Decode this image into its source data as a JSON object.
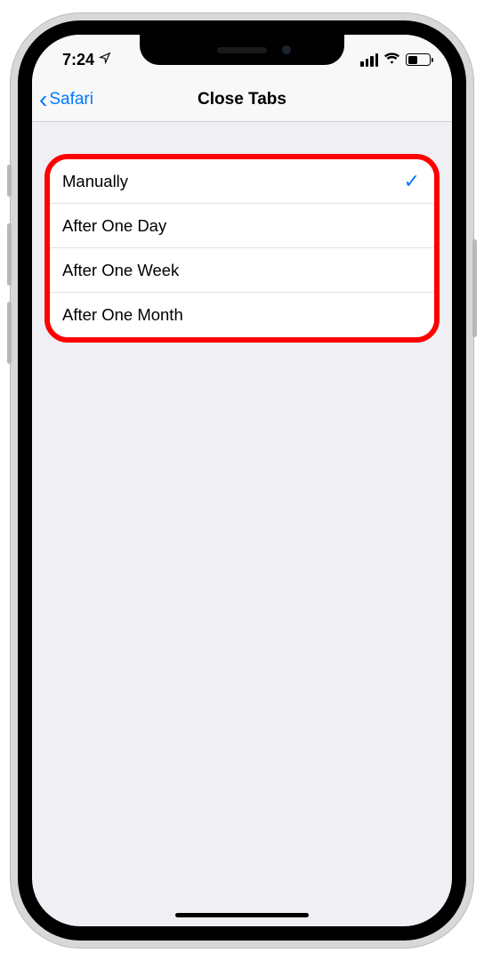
{
  "status": {
    "time": "7:24",
    "location_icon": "location-arrow"
  },
  "nav": {
    "back_label": "Safari",
    "title": "Close Tabs"
  },
  "options": [
    {
      "label": "Manually",
      "selected": true
    },
    {
      "label": "After One Day",
      "selected": false
    },
    {
      "label": "After One Week",
      "selected": false
    },
    {
      "label": "After One Month",
      "selected": false
    }
  ]
}
